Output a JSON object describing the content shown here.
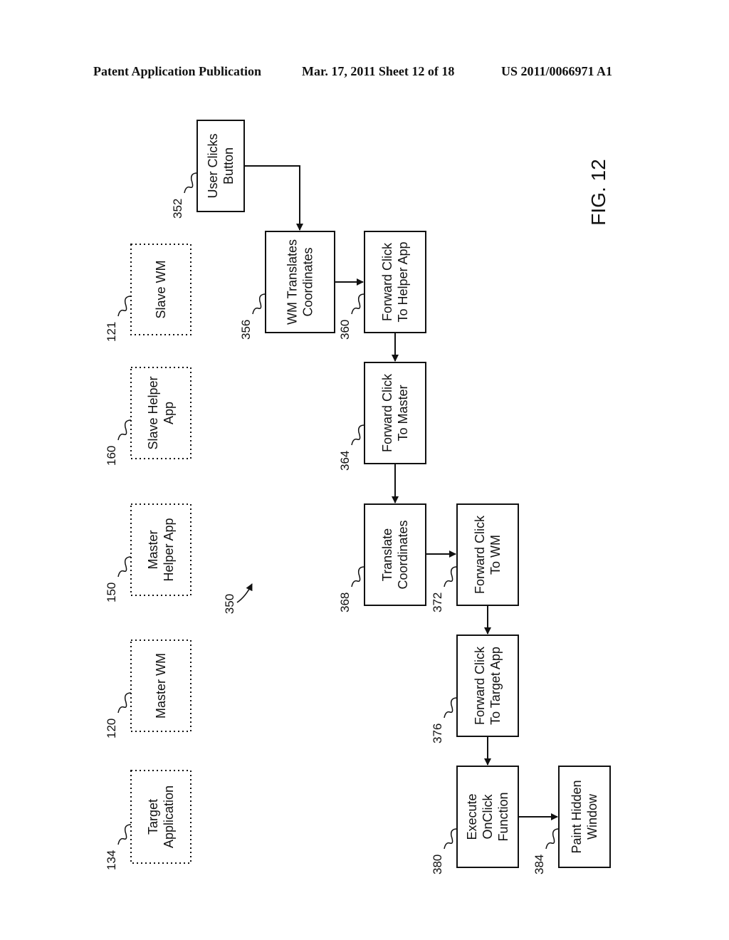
{
  "header": {
    "left": "Patent Application Publication",
    "center": "Mar. 17, 2011  Sheet 12 of 18",
    "right": "US 2011/0066971 A1"
  },
  "figure": {
    "label": "FIG. 12",
    "ref": "350"
  },
  "components": [
    {
      "ref": "121",
      "lines": [
        "Slave WM"
      ]
    },
    {
      "ref": "160",
      "lines": [
        "Slave Helper",
        "App"
      ]
    },
    {
      "ref": "150",
      "lines": [
        "Master",
        "Helper App"
      ]
    },
    {
      "ref": "120",
      "lines": [
        "Master WM"
      ]
    },
    {
      "ref": "134",
      "lines": [
        "Target",
        "Application"
      ]
    }
  ],
  "steps": [
    {
      "ref": "352",
      "lines": [
        "User Clicks",
        "Button"
      ]
    },
    {
      "ref": "356",
      "lines": [
        "WM Translates",
        "Coordinates"
      ]
    },
    {
      "ref": "360",
      "lines": [
        "Forward Click",
        "To Helper App"
      ]
    },
    {
      "ref": "364",
      "lines": [
        "Forward Click",
        "To Master"
      ]
    },
    {
      "ref": "368",
      "lines": [
        "Translate",
        "Coordinates"
      ]
    },
    {
      "ref": "372",
      "lines": [
        "Forward Click",
        "To WM"
      ]
    },
    {
      "ref": "376",
      "lines": [
        "Forward Click",
        "To Target App"
      ]
    },
    {
      "ref": "380",
      "lines": [
        "Execute",
        "OnClick",
        "Function"
      ]
    },
    {
      "ref": "384",
      "lines": [
        "Paint Hidden",
        "Window"
      ]
    }
  ],
  "flow": [
    [
      "352",
      "356"
    ],
    [
      "356",
      "360"
    ],
    [
      "360",
      "364"
    ],
    [
      "364",
      "368"
    ],
    [
      "368",
      "372"
    ],
    [
      "372",
      "376"
    ],
    [
      "376",
      "380"
    ],
    [
      "380",
      "384"
    ]
  ]
}
